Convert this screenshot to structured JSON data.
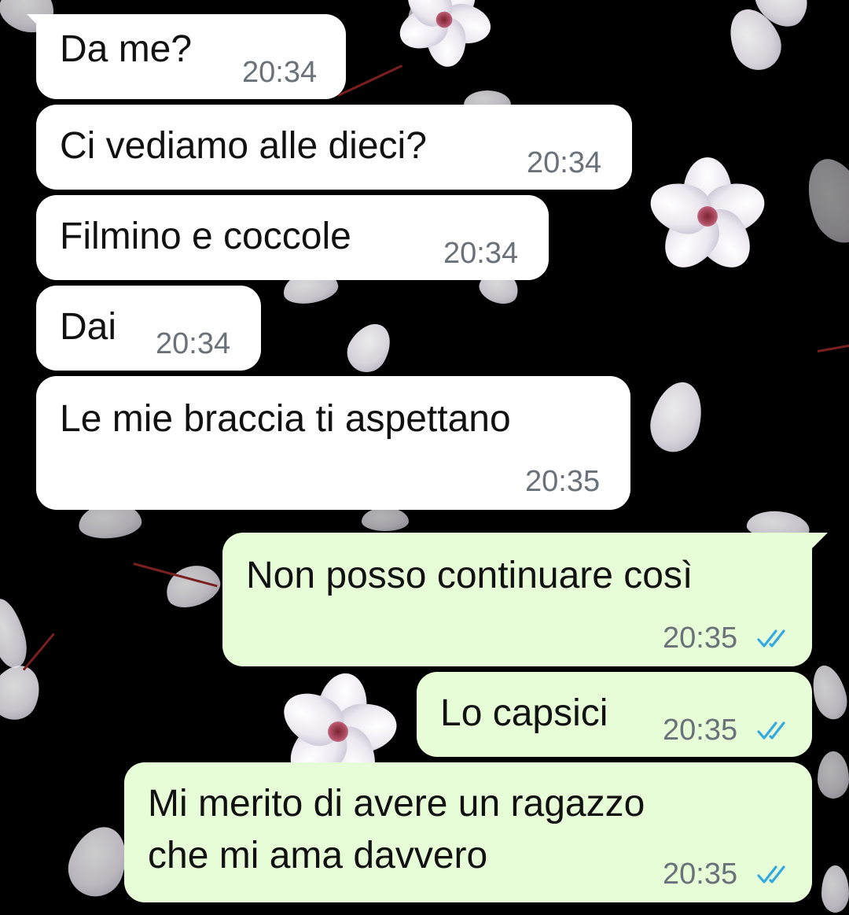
{
  "conversation": {
    "received": [
      {
        "text": "Da me?",
        "time": "20:34"
      },
      {
        "text": "Ci vediamo alle dieci?",
        "time": "20:34"
      },
      {
        "text": "Filmino e coccole",
        "time": "20:34"
      },
      {
        "text": "Dai",
        "time": "20:34"
      },
      {
        "text": "Le mie braccia ti aspettano",
        "time": "20:35"
      }
    ],
    "sent": [
      {
        "text": "Non posso continuare così",
        "time": "20:35",
        "status": "read"
      },
      {
        "text": "Lo capsici",
        "time": "20:35",
        "status": "read"
      },
      {
        "text": "Mi merito di avere un ragazzo\nche mi ama davvero",
        "time": "20:35",
        "status": "read"
      }
    ]
  },
  "colors": {
    "received_bubble": "#ffffff",
    "sent_bubble": "#e7fdd8",
    "read_ticks": "#34a9df",
    "timestamp": "#6a7179",
    "wallpaper": "#000000"
  },
  "icons": {
    "read_receipt": "double-check-icon"
  }
}
